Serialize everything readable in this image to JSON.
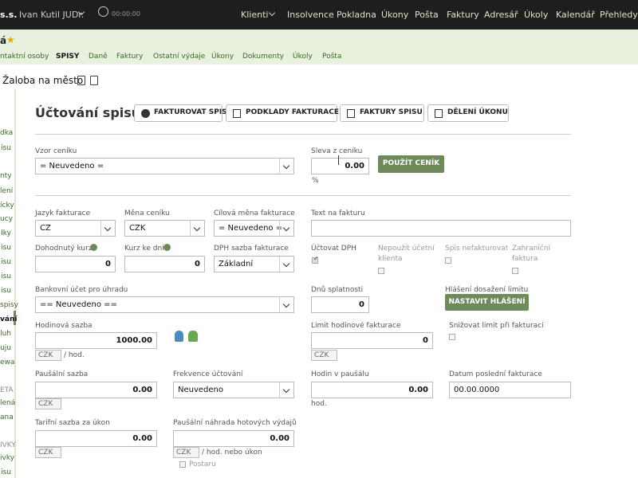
{
  "topbar": {
    "app_fragment": "s.s.",
    "user": "Ivan Kutil JUDr.",
    "timer": "00:00:00",
    "nav": [
      "Klienti",
      "Insolvence",
      "Pokladna",
      "Úkony",
      "Pošta",
      "Faktury",
      "Adresář",
      "Úkoly",
      "Kalendář",
      "Přehledy"
    ]
  },
  "header": {
    "case_fragment": "á",
    "subnav": [
      "ntaktní osoby",
      "SPISY",
      "Daně",
      "Faktury",
      "Ostatní výdaje",
      "Úkony",
      "Dokumenty",
      "Úkoly",
      "Pošta"
    ],
    "case_title": "Žaloba na město"
  },
  "sidebar": {
    "items": [
      "dka",
      "isu",
      "nty",
      "lení",
      "ícky",
      "ucy",
      "lky",
      "isu",
      "isu",
      "isu",
      "isu",
      "spisy",
      "vání",
      "luh",
      "uju",
      "ewa",
      "ETA",
      "lená",
      "ana",
      "IVKY",
      "ivky",
      "isu"
    ]
  },
  "main": {
    "title": "Účtování spisu",
    "tabs": [
      "FAKTUROVAT SPIS",
      "PODKLADY FAKTURACE",
      "FAKTURY SPISU",
      "DĚLENÍ ÚKONU"
    ],
    "vzor_ceniku": {
      "label": "Vzor ceníku",
      "value": "= Neuvedeno ="
    },
    "sleva": {
      "label": "Sleva z ceníku",
      "value": "0.00",
      "unit": "%"
    },
    "pouzit_cenik": "POUŽÍT CENÍK",
    "jazyk": {
      "label": "Jazyk fakturace",
      "value": "CZ"
    },
    "mena_ceniku": {
      "label": "Měna ceníku",
      "value": "CZK"
    },
    "cilova_mena": {
      "label": "Cílová měna fakturace",
      "value": "= Neuvedeno ="
    },
    "text_na_fakturu": {
      "label": "Text na fakturu",
      "value": ""
    },
    "duhodnuty_kurz": {
      "label": "Dohodnutý kurz",
      "value": "0"
    },
    "kurz_ke_dni": {
      "label": "Kurz ke dni",
      "value": "0"
    },
    "dph_sazba": {
      "label": "DPH sazba fakturace",
      "value": "Základní"
    },
    "uctovat_dph": {
      "label": "Účtovat DPH",
      "checked": true
    },
    "nepouzit_ucetni": {
      "label1": "Nepoužít účetní",
      "label2": "klienta"
    },
    "spis_nefakturovat": {
      "label": "Spis nefakturovat"
    },
    "zahranicni": {
      "label1": "Zahraniční",
      "label2": "faktura"
    },
    "bankovni_ucet": {
      "label": "Bankovní účet pro úhradu",
      "value": "== Neuvedeno =="
    },
    "dnu_splatnosti": {
      "label": "Dnů splatnosti",
      "value": "0"
    },
    "hlaseni": {
      "label": "Hlášení dosažení limitu",
      "button": "NASTAVIT HLÁŠENÍ"
    },
    "hodinova_sazba": {
      "label": "Hodinová sazba",
      "value": "1000.00",
      "unit": "CZK",
      "suffix": "/ hod."
    },
    "limit_hodinove": {
      "label": "Limit hodinové fakturace",
      "value": "0",
      "unit": "CZK"
    },
    "snizovat_limit": {
      "label": "Snižovat limit při fakturaci"
    },
    "pausalni_sazba": {
      "label": "Paušální sazba",
      "value": "0.00",
      "unit": "CZK"
    },
    "frekvence": {
      "label": "Frekvence účtování",
      "value": "Neuvedeno"
    },
    "hodin_v_pausalu": {
      "label": "Hodin v paušálu",
      "value": "0.00",
      "unit": "hod."
    },
    "datum_posledni": {
      "label": "Datum poslední fakturace",
      "value": "00.00.0000"
    },
    "tarifni_sazba": {
      "label": "Tarifní sazba za úkon",
      "value": "0.00",
      "unit": "CZK"
    },
    "pausalni_nahrada": {
      "label": "Paušální náhrada hotových výdajů",
      "value": "0.00",
      "unit": "CZK",
      "suffix": "/ hod. nebo úkon",
      "option": "Postaru"
    }
  },
  "colors": {
    "topbar": "#1e1e1e",
    "accent_green": "#6e8a5b",
    "header_band": "#e8f0de",
    "link_green": "#3a6b24"
  }
}
